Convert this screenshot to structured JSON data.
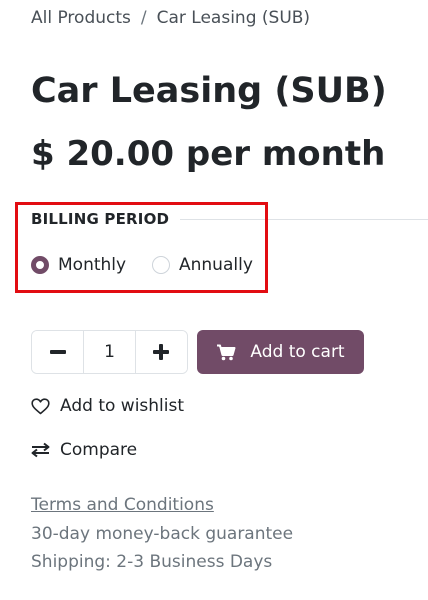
{
  "breadcrumb": {
    "items": [
      "All Products",
      "Car Leasing (SUB)"
    ],
    "separator": "/"
  },
  "product": {
    "name": "Car Leasing (SUB)",
    "price": "$ 20.00 per month"
  },
  "billing": {
    "label": "BILLING PERIOD",
    "options": [
      {
        "label": "Monthly",
        "selected": true
      },
      {
        "label": "Annually",
        "selected": false
      }
    ]
  },
  "quantity": {
    "value": "1"
  },
  "actions": {
    "add_to_cart": "Add to cart",
    "wishlist": "Add to wishlist",
    "compare": "Compare"
  },
  "footer": {
    "terms": "Terms and Conditions",
    "guarantee": "30-day money-back guarantee",
    "shipping": "Shipping: 2-3 Business Days"
  },
  "colors": {
    "accent": "#714b67",
    "highlight": "#e20c12",
    "muted_text": "#6c757d"
  },
  "icons": [
    "minus-icon",
    "plus-icon",
    "cart-icon",
    "heart-icon",
    "compare-arrows-icon"
  ]
}
